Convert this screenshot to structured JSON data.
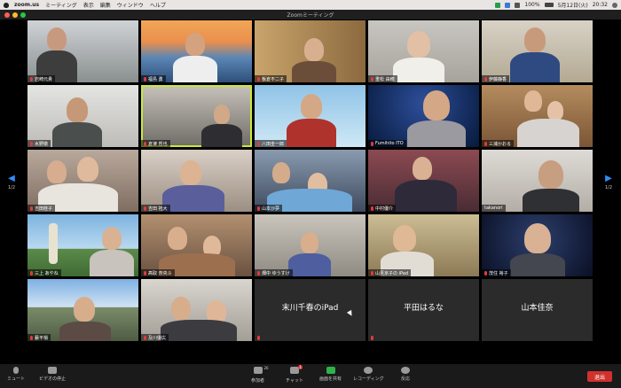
{
  "menubar": {
    "items": [
      "zoom.us",
      "ミーティング",
      "表示",
      "編集",
      "ウィンドウ",
      "ヘルプ"
    ],
    "battery": "100%",
    "date": "5月12日(火)",
    "time": "20:32"
  },
  "window": {
    "title": "Zoomミーティング"
  },
  "page_indicator": {
    "left": "1/2",
    "right": "1/2"
  },
  "tiles": [
    {
      "name": "岩崎元貴"
    },
    {
      "name": "福島 勇"
    },
    {
      "name": "板倉不二子"
    },
    {
      "name": "重松 由穂"
    },
    {
      "name": "伊藤静香"
    },
    {
      "name": "水野徹"
    },
    {
      "name": "倉津 哲也"
    },
    {
      "name": "八田圭一郎"
    },
    {
      "name": "Fumihito ITO"
    },
    {
      "name": "三浦かおる"
    },
    {
      "name": "吉田桂子"
    },
    {
      "name": "吉田 拓大"
    },
    {
      "name": "山本沙夢"
    },
    {
      "name": "中村優介"
    },
    {
      "name": "takanori"
    },
    {
      "name": "三上 あやね"
    },
    {
      "name": "髙取 奈央斗"
    },
    {
      "name": "畑中 ゆうすけ"
    },
    {
      "name": "山見京子の iPad"
    },
    {
      "name": "茂住 裕子"
    },
    {
      "name": "藪平梢"
    },
    {
      "name": "及川優広"
    },
    {
      "name": "",
      "text": "末川千春のiPad"
    },
    {
      "name": "",
      "text": "平田はるな"
    },
    {
      "name": "",
      "text": "山本佳奈"
    }
  ],
  "toolbar": {
    "mute": "ミュート",
    "video": "ビデオの停止",
    "participants": "参加者",
    "participants_count": "26",
    "chat": "チャット",
    "chat_badge": "1",
    "share": "画面を共有",
    "record": "レコーディング",
    "reactions": "反応",
    "end": "退出"
  },
  "colors": {
    "accent": "#2c8ef8",
    "end_button": "#d0312d",
    "speaker_highlight": "#c8e83a"
  }
}
